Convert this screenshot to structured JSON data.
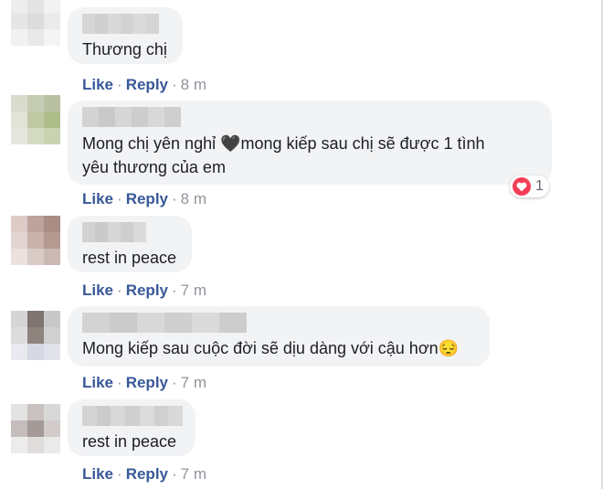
{
  "colors": {
    "link": "#385898",
    "bubble": "#f2f3f5",
    "meta": "#90949c",
    "heart": "#f33e58"
  },
  "action_labels": {
    "like": "Like",
    "reply": "Reply",
    "separator": "·"
  },
  "comments": [
    {
      "text": "Thương chị",
      "time": "8 m"
    },
    {
      "text": "Mong chị yên nghỉ 🖤mong kiếp sau chị sẽ được 1 tình\nyêu thương của em",
      "time": "8 m",
      "reaction": {
        "icon": "heart-icon",
        "count": "1"
      }
    },
    {
      "text": "rest in peace",
      "time": "7 m"
    },
    {
      "text": "Mong kiếp sau cuộc đời sẽ dịu dàng với cậu hơn😔",
      "time": "7 m"
    },
    {
      "text": "rest in peace",
      "time": "7 m"
    }
  ]
}
